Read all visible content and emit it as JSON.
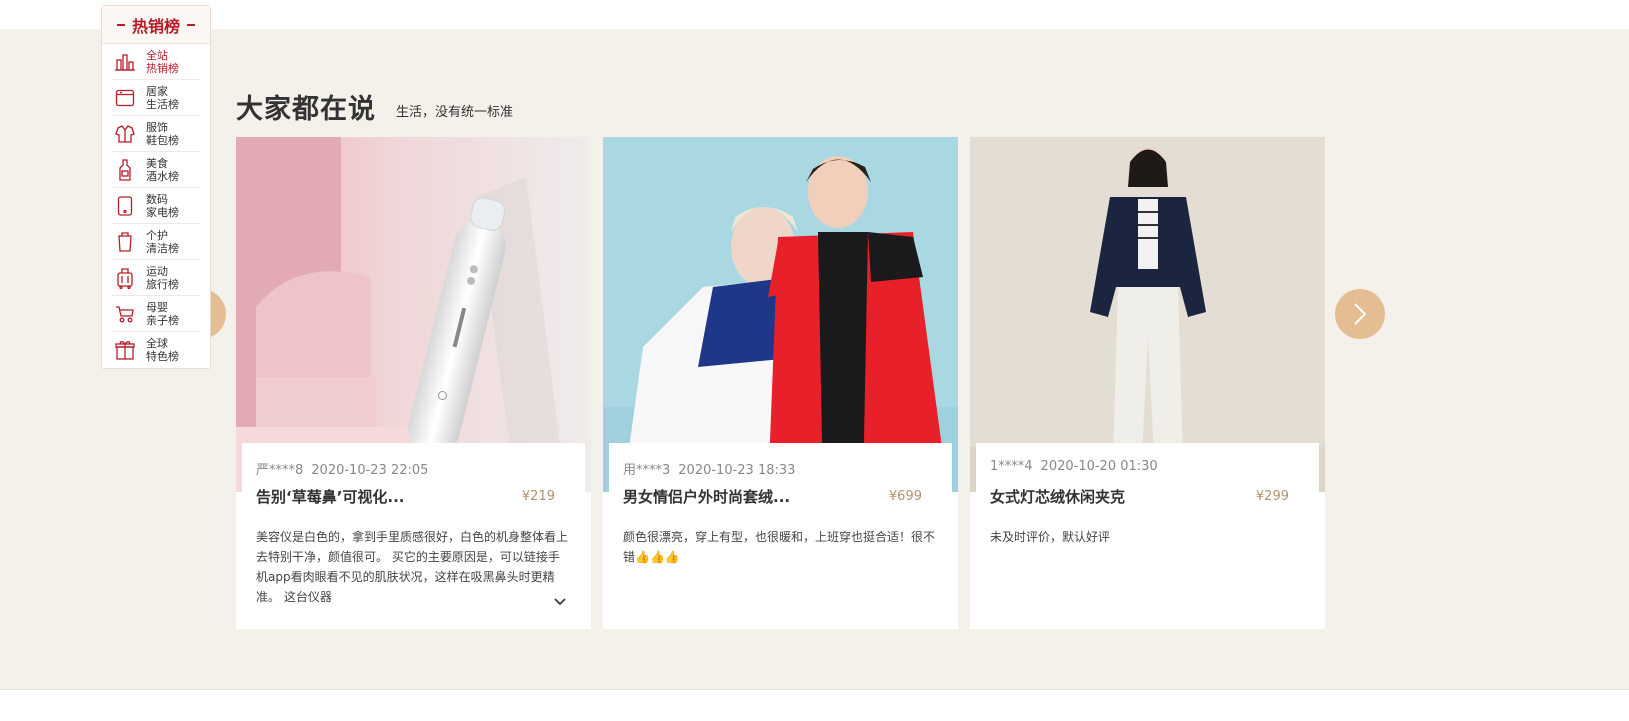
{
  "ranking": {
    "title": "热销榜",
    "items": [
      {
        "line1": "全站",
        "line2": "热销榜",
        "icon": "bar-chart-icon",
        "active": true
      },
      {
        "line1": "居家",
        "line2": "生活榜",
        "icon": "home-appliance-icon"
      },
      {
        "line1": "服饰",
        "line2": "鞋包榜",
        "icon": "clothing-icon"
      },
      {
        "line1": "美食",
        "line2": "酒水榜",
        "icon": "bottle-icon"
      },
      {
        "line1": "数码",
        "line2": "家电榜",
        "icon": "device-icon"
      },
      {
        "line1": "个护",
        "line2": "清洁榜",
        "icon": "personal-care-icon"
      },
      {
        "line1": "运动",
        "line2": "旅行榜",
        "icon": "luggage-icon"
      },
      {
        "line1": "母婴",
        "line2": "亲子榜",
        "icon": "stroller-icon"
      },
      {
        "line1": "全球",
        "line2": "特色榜",
        "icon": "gift-icon"
      }
    ]
  },
  "section": {
    "title": "大家都在说",
    "subtitle": "生活，没有统一标准"
  },
  "cards": [
    {
      "user": "严****8",
      "time": "2020-10-23 22:05",
      "title": "告别‘草莓鼻’可视化...",
      "price": "¥219",
      "desc": "美容仪是白色的，拿到手里质感很好，白色的机身整体看上去特别干净，颜值很可。 买它的主要原因是，可以链接手机app看肉眼看不见的肌肤状况，这样在吸黑鼻头时更精准。 这台仪器",
      "image": "pore-vacuum-device-photo"
    },
    {
      "user": "用****3",
      "time": "2020-10-23 18:33",
      "title": "男女情侣户外时尚套绒...",
      "price": "¥699",
      "desc": "颜色很漂亮，穿上有型，也很暖和，上班穿也挺合适！很不错👍👍👍",
      "image": "couple-jackets-photo"
    },
    {
      "user": "1****4",
      "time": "2020-10-20 01:30",
      "title": "女式灯芯绒休闲夹克",
      "price": "¥299",
      "desc": "未及时评价，默认好评",
      "image": "corduroy-jacket-photo"
    }
  ],
  "colors": {
    "brand_red": "#b71d29",
    "section_bg": "#f4f0ea",
    "arrow": "#e4bd93",
    "price": "#b4936b"
  }
}
